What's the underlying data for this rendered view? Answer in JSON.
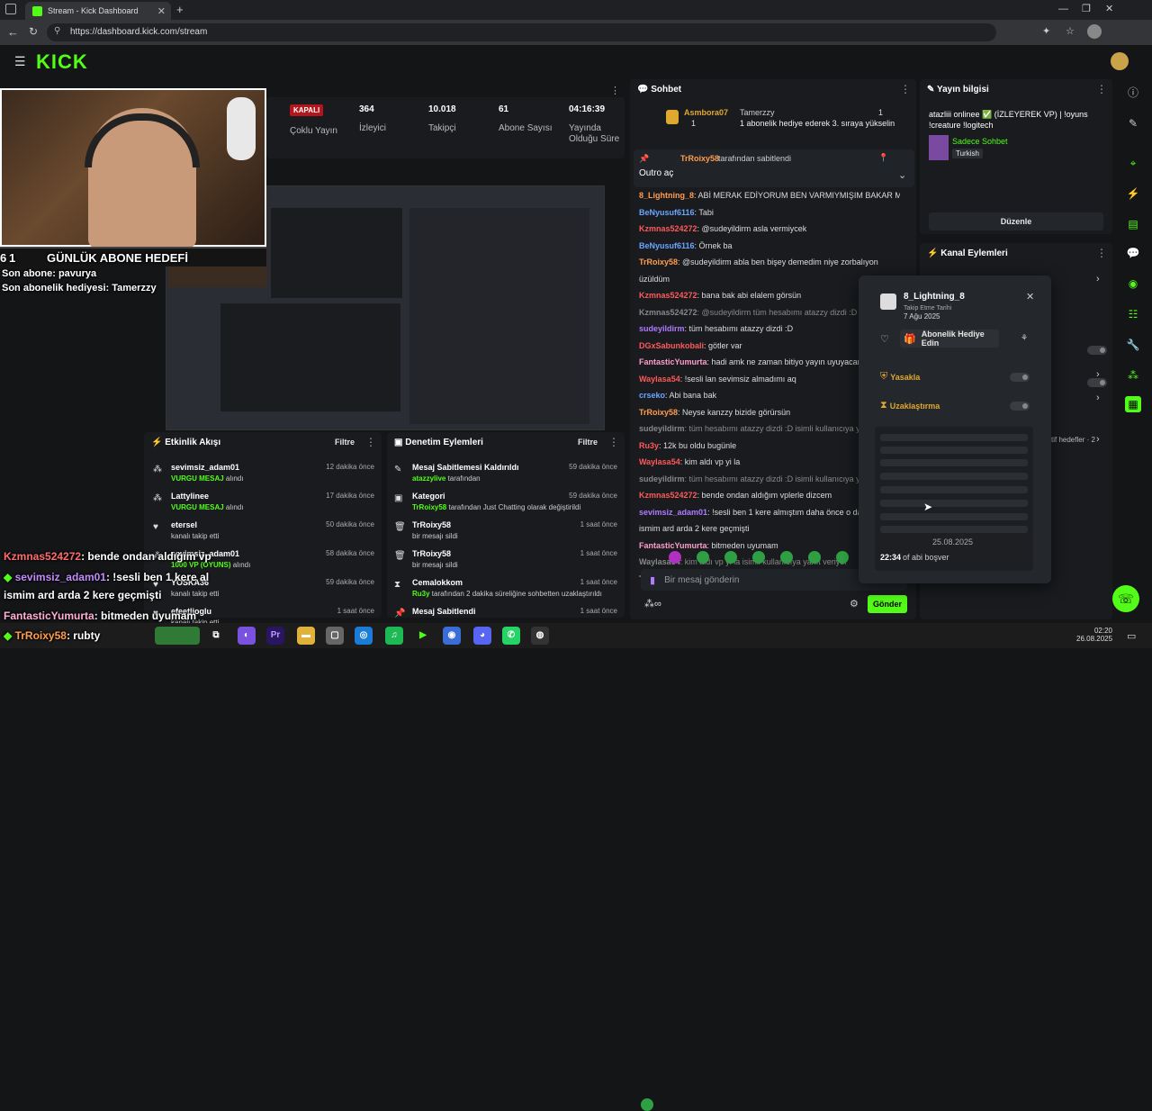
{
  "browser": {
    "tab_title": "Stream - Kick Dashboard",
    "url": "https://dashboard.kick.com/stream",
    "new_tab": "+",
    "clock_time": "02:20",
    "clock_date": "26.08.2025"
  },
  "header": {
    "logo": "KICK"
  },
  "stats": {
    "status": "KAPALI",
    "multi_stream": "Çoklu Yayın",
    "viewers_value": "364",
    "viewers_label": "İzleyici",
    "followers_value": "10.018",
    "followers_label": "Takipçi",
    "subs_value": "61",
    "subs_label": "Abone Sayısı",
    "uptime_value": "04:16:39",
    "uptime_label": "Yayında Olduğu Süre"
  },
  "overlay": {
    "goal_left": "1",
    "goal_title": "GÜNLÜK ABONE HEDEFİ",
    "goal_right": "6",
    "last_sub": "Son abone: pavurya",
    "last_gift": "Son abonelik hediyesi: Tamerzzy",
    "chat1_user": "Kzmnas524272",
    "chat1_msg": ": bende ondan aldığım vp",
    "chat2_user": "sevimsiz_adam01",
    "chat2_msg": ": !sesli ben 1 kere al",
    "chat3": "ismim ard arda 2 kere geçmişti",
    "chat4_user": "FantasticYumurta",
    "chat4_msg": ": bitmeden uyumam",
    "chat5_user": "TrRoixy58",
    "chat5_msg": ": rubty"
  },
  "chat": {
    "title": "Sohbet",
    "gift_user": "Asmbora07",
    "gift_count": "1",
    "gift_from": "Tamerzzy",
    "gift_text": "1 abonelik hediye ederek 3. sıraya yükselin",
    "pinned_by": "TrRoixy58",
    "pinned_by_suffix": "tarafından sabitlendi",
    "pinned_msg": "Outro aç",
    "lines": [
      {
        "user": "8_Lightning_8",
        "color": "#ff9e4d",
        "msg": ": ABİ MERAK EDİYORUM BEN VARMIYMIŞIM BAKAR MISIN"
      },
      {
        "user": "BeNyusuf6116",
        "color": "#6aa6ff",
        "msg": ": Tabi"
      },
      {
        "user": "Kzmnas524272",
        "color": "#ff5a5a",
        "msg": ": @sudeyildirm asla vermiycek"
      },
      {
        "user": "BeNyusuf6116",
        "color": "#6aa6ff",
        "msg": ": Örnek ba"
      },
      {
        "user": "TrRoixy58",
        "color": "#ff9e4d",
        "msg": ": @sudeyildirm abla ben bişey demedim niye zorbalıyon"
      },
      {
        "user": "",
        "color": "#ddd",
        "msg": "üzüldüm"
      },
      {
        "user": "Kzmnas524272",
        "color": "#ff5a5a",
        "msg": ": bana bak abi elalem görsün"
      },
      {
        "user": "Kzmnas524272",
        "color": "#888",
        "msg": ": @sudeyildirm tüm hesabımı atazzy dizdi :D isimli kullanıcıya yanıt"
      },
      {
        "user": "sudeyildirm",
        "color": "#b07bff",
        "msg": ": tüm hesabımı atazzy dizdi :D"
      },
      {
        "user": "DGxSabunkobali",
        "color": "#ff5a5a",
        "msg": ": götler var"
      },
      {
        "user": "FantasticYumurta",
        "color": "#ff9ecb",
        "msg": ": hadi amk ne zaman bitiyo yayın uyuyacam"
      },
      {
        "user": "Waylasa54",
        "color": "#ff5a5a",
        "msg": ": !sesli lan sevimsiz almadımı aq"
      },
      {
        "user": "crseko",
        "color": "#6aa6ff",
        "msg": ": Abi bana bak"
      },
      {
        "user": "TrRoixy58",
        "color": "#ff9e4d",
        "msg": ": Neyse kanzzy bizide görürsün"
      },
      {
        "user": "sudeyildirm",
        "color": "#888",
        "msg": ": tüm hesabımı atazzy dizdi :D isimli kullanıcıya yanıt veriyor"
      },
      {
        "user": "Ru3y",
        "color": "#ff5a5a",
        "msg": ": 12k bu oldu bugünle"
      },
      {
        "user": "Waylasa54",
        "color": "#ff5a5a",
        "msg": ": kim aldı vp yi la"
      },
      {
        "user": "sudeyildirm",
        "color": "#888",
        "msg": ": tüm hesabımı atazzy dizdi :D isimli kullanıcıya yanıt"
      },
      {
        "user": "Kzmnas524272",
        "color": "#ff5a5a",
        "msg": ": bende ondan aldığım vplerle dizcem"
      },
      {
        "user": "sevimsiz_adam01",
        "color": "#b07bff",
        "msg": ": !sesli ben 1 kere almıştım daha önce o da ba"
      },
      {
        "user": "",
        "color": "#ddd",
        "msg": "ismim ard arda 2 kere geçmişti"
      },
      {
        "user": "FantasticYumurta",
        "color": "#ff9ecb",
        "msg": ": bitmeden uyumam"
      },
      {
        "user": "Waylasa54",
        "color": "#888",
        "msg": ": kim aldı vp yi la isimli kullanıcıya yanıt veriyor"
      },
      {
        "user": "TrRoixy58",
        "color": "#ff9e4d",
        "msg": ": rubty"
      }
    ],
    "input_placeholder": "Bir mesaj gönderin",
    "send_label": "Gönder"
  },
  "stream_info": {
    "title": "Yayın bilgisi",
    "stream_title": "atazliii onlinee ✅ (İZLEYEREK VP) | !oyuns !creature !logitech",
    "mode": "Sadece Sohbet",
    "language": "Turkish",
    "edit_label": "Düzenle"
  },
  "channel_actions": {
    "title": "Kanal Eylemleri",
    "goals_label": "tif hedefler · 2"
  },
  "user_card": {
    "username": "8_Lightning_8",
    "follow_label": "Takip Etme Tarihi",
    "follow_date": "7 Ağu 2025",
    "gift_label": "Abonelik Hediye Edin",
    "ban_label": "Yasakla",
    "timeout_label": "Uzaklaştırma",
    "date": "25.08.2025",
    "msg_time": "22:34",
    "msg_text": "of abi boşver"
  },
  "activity": {
    "title": "Etkinlik Akışı",
    "filter_label": "Filtre",
    "items": [
      {
        "name": "sevimsiz_adam01",
        "tag": "VURGU MESAJ",
        "desc": " alındı",
        "time": "12 dakika önce"
      },
      {
        "name": "Lattylinee",
        "tag": "VURGU MESAJ",
        "desc": " alındı",
        "time": "17 dakika önce"
      },
      {
        "name": "etersel",
        "tag": "",
        "desc": "kanalı takip etti",
        "time": "50 dakika önce"
      },
      {
        "name": "sevimsiz_adam01",
        "tag": "1000 VP (OYUNS)",
        "desc": " alındı",
        "time": "58 dakika önce"
      },
      {
        "name": "YOSKA36",
        "tag": "",
        "desc": "kanalı takip etti",
        "time": "59 dakika önce"
      },
      {
        "name": "efeetlioglu",
        "tag": "",
        "desc": "kanalı takip etti",
        "time": "1 saat önce"
      }
    ]
  },
  "moderation": {
    "title": "Denetim Eylemleri",
    "filter_label": "Filtre",
    "items": [
      {
        "name": "Mesaj Sabitlemesi Kaldırıldı",
        "who": "atazzylive",
        "desc": " tarafından",
        "time": "59 dakika önce"
      },
      {
        "name": "Kategori",
        "who": "TrRoixy58",
        "desc": " tarafından Just Chatting olarak değiştirildi",
        "time": "59 dakika önce"
      },
      {
        "name": "TrRoixy58",
        "who": "",
        "desc": "bir mesajı sildi",
        "time": "1 saat önce"
      },
      {
        "name": "TrRoixy58",
        "who": "",
        "desc": "bir mesajı sildi",
        "time": "1 saat önce"
      },
      {
        "name": "Cemalokkom",
        "who": "Ru3y",
        "desc": " tarafından 2 dakika süreliğine sohbetten uzaklaştırıldı",
        "time": "1 saat önce"
      },
      {
        "name": "Mesaj Sabitlendi",
        "who": "",
        "desc": "",
        "time": "1 saat önce"
      }
    ]
  },
  "colors": {
    "brand": "#53fc18",
    "panel": "#191b1f",
    "bg": "#141517",
    "danger": "#b3161c"
  }
}
